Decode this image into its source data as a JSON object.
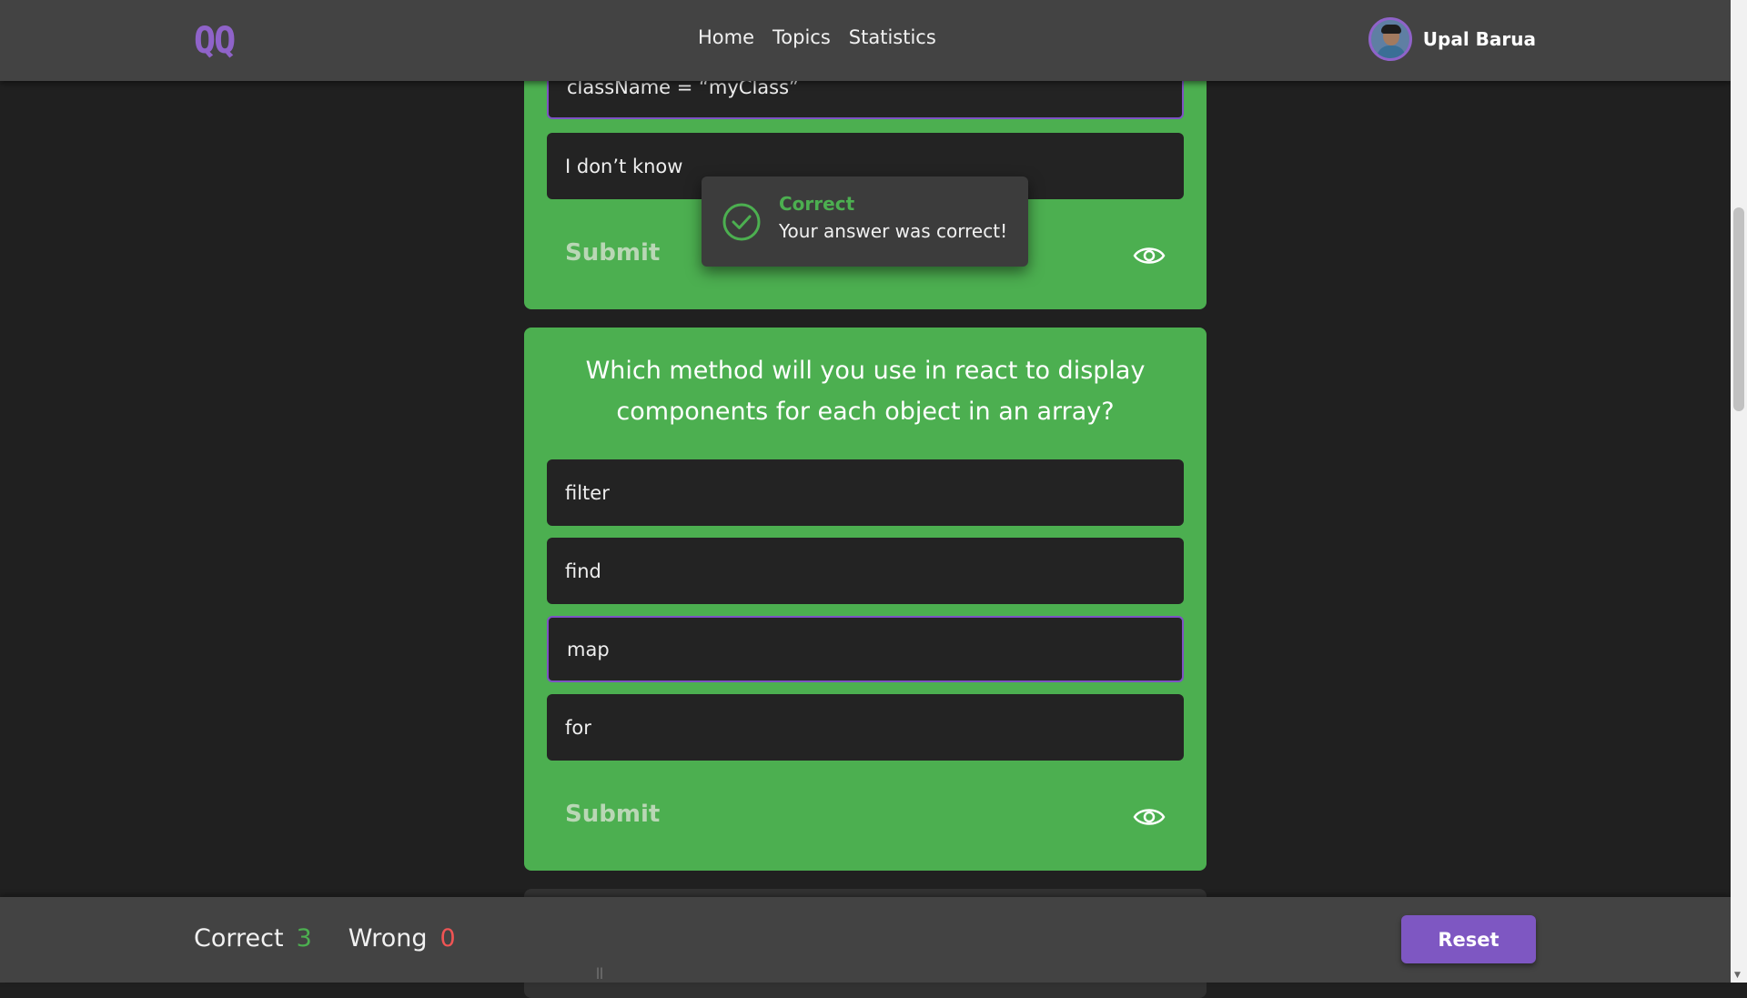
{
  "header": {
    "logo": "QQ",
    "nav": [
      {
        "label": "Home"
      },
      {
        "label": "Topics"
      },
      {
        "label": "Statistics"
      }
    ],
    "user_name": "Upal Barua"
  },
  "card1": {
    "options": [
      "className = “myClass”",
      "I don’t know"
    ],
    "selected_index": 0,
    "submit_label": "Submit",
    "eye_icon": "eye-icon"
  },
  "toast": {
    "icon": "check-circle-icon",
    "title": "Correct",
    "message": "Your answer was correct!"
  },
  "card2": {
    "question": "Which method will you use in react to display components for each object in an array?",
    "options": [
      "filter",
      "find",
      "map",
      "for"
    ],
    "selected_index": 2,
    "submit_label": "Submit",
    "eye_icon": "eye-icon"
  },
  "footer": {
    "correct_label": "Correct",
    "correct_count": "3",
    "wrong_label": "Wrong",
    "wrong_count": "0",
    "reset_label": "Reset"
  },
  "colors": {
    "card_green": "#4caf50",
    "accent_purple": "#7e57c2",
    "wrong_red": "#f05454"
  }
}
